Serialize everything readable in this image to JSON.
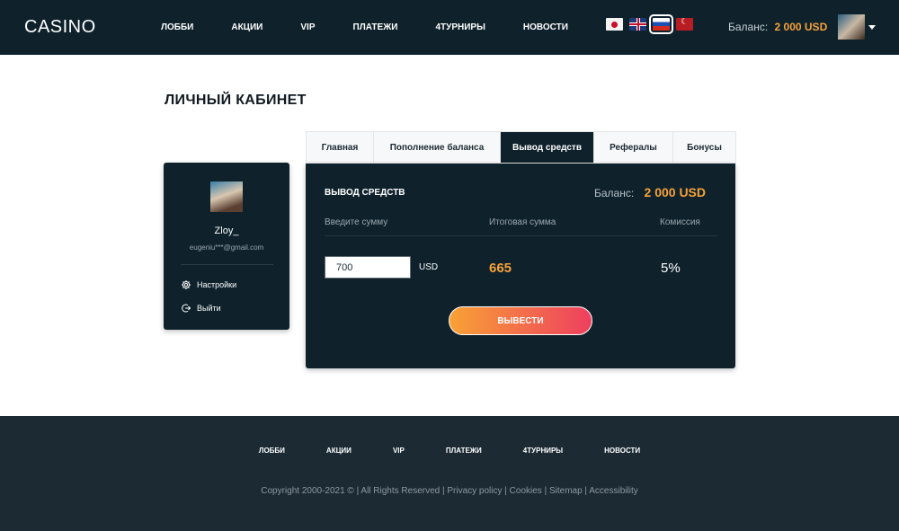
{
  "header": {
    "logo": "CASINO",
    "nav": [
      "ЛОББИ",
      "АКЦИИ",
      "VIP",
      "ПЛАТЕЖИ",
      "4ТУРНИРЫ",
      "НОВОСТИ"
    ],
    "flags": [
      "japan-flag-icon",
      "uk-flag-icon",
      "russia-flag-icon",
      "turkey-flag-icon"
    ],
    "active_flag": "russia-flag-icon",
    "balance_label": "Баланс:",
    "balance_value": "2 000 USD"
  },
  "page": {
    "title": "ЛИЧНЫЙ КАБИНЕТ"
  },
  "profile": {
    "name": "Zloy_",
    "email": "eugeniu***@gmail.com",
    "settings_label": "Настройки",
    "logout_label": "Выйти"
  },
  "tabs": [
    "Главная",
    "Пополнение баланса",
    "Вывод средств",
    "Рефералы",
    "Бонусы"
  ],
  "active_tab": "Вывод средств",
  "withdraw": {
    "title": "ВЫВОД СРЕДСТВ",
    "balance_label": "Баланс:",
    "balance_value": "2 000 USD",
    "col_amount": "Введите сумму",
    "col_total": "Итоговая сумма",
    "col_commission": "Комиссия",
    "amount_value": "700",
    "currency": "USD",
    "total_value": "665",
    "commission_value": "5%",
    "button_label": "ВЫВЕСТИ"
  },
  "footer": {
    "nav": [
      "ЛОББИ",
      "АКЦИИ",
      "VIP",
      "ПЛАТЕЖИ",
      "4ТУРНИРЫ",
      "НОВОСТИ"
    ],
    "copyright": "Copyright 2000-2021 © | All Rights Reserved |",
    "links": [
      "Privacy policy",
      "Cookies",
      "Sitemap",
      "Accessibility"
    ]
  },
  "colors": {
    "dark_bg": "#0f222c",
    "footer_bg": "#1b2a33",
    "accent_orange": "#f7a23a",
    "button_gradient_end": "#ee3f5f"
  }
}
